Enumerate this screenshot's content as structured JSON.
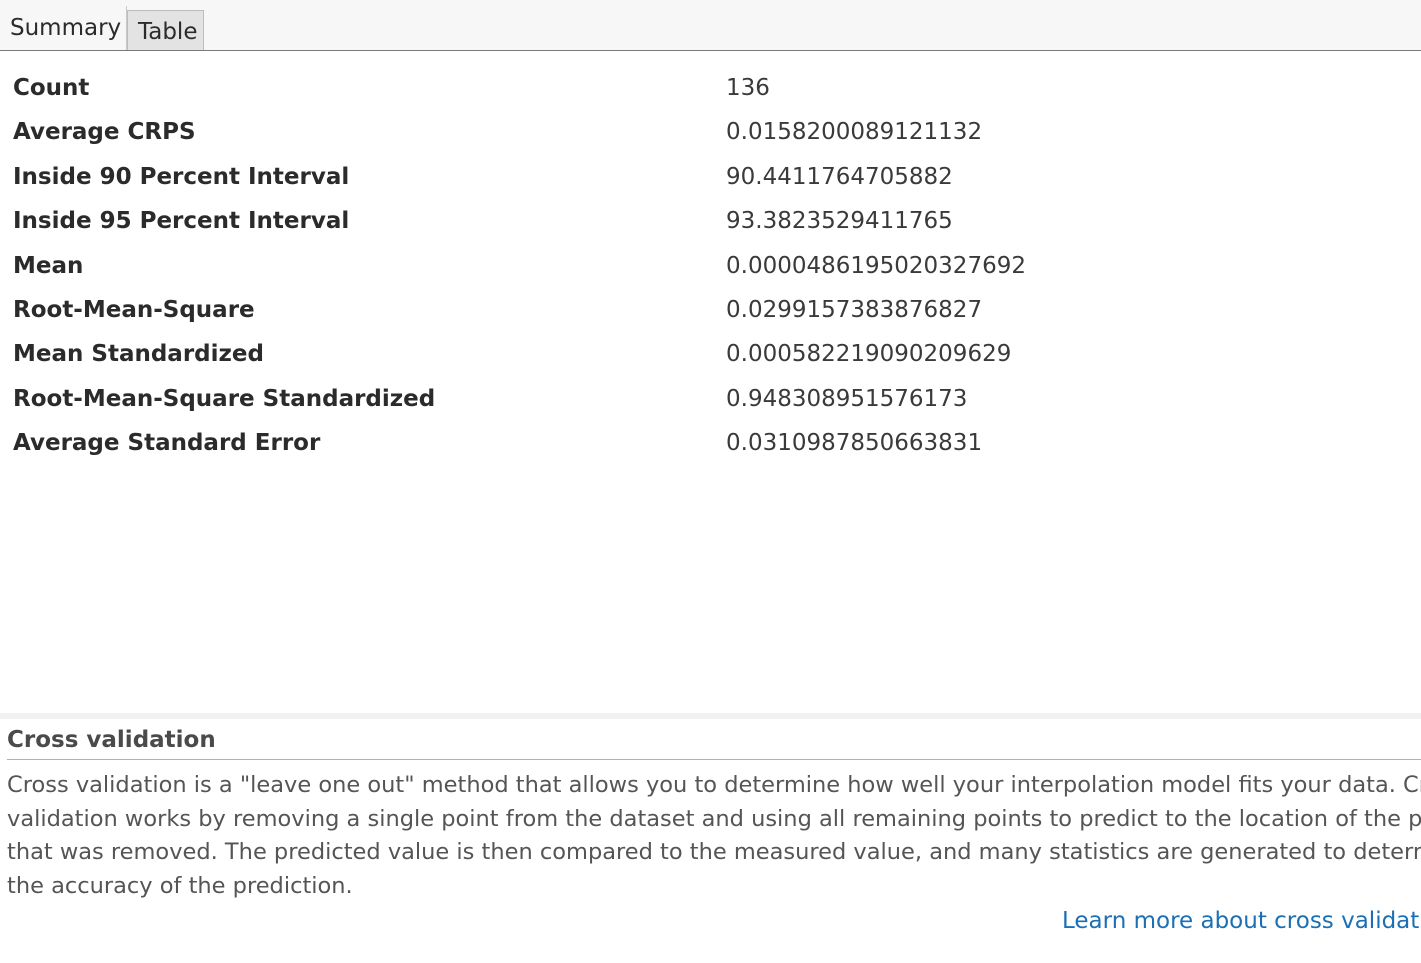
{
  "tabs": [
    {
      "label": "Summary",
      "active": true
    },
    {
      "label": "Table",
      "active": false
    }
  ],
  "stats": [
    {
      "label": "Count",
      "value": "136"
    },
    {
      "label": "Average CRPS",
      "value": "0.0158200089121132"
    },
    {
      "label": "Inside 90 Percent Interval",
      "value": "90.4411764705882"
    },
    {
      "label": "Inside 95 Percent Interval",
      "value": "93.3823529411765"
    },
    {
      "label": "Mean",
      "value": "0.0000486195020327692"
    },
    {
      "label": "Root-Mean-Square",
      "value": "0.0299157383876827"
    },
    {
      "label": "Mean Standardized",
      "value": "0.000582219090209629"
    },
    {
      "label": "Root-Mean-Square Standardized",
      "value": "0.948308951576173"
    },
    {
      "label": "Average Standard Error",
      "value": "0.0310987850663831"
    }
  ],
  "help": {
    "title": "Cross validation",
    "lines": [
      "Cross validation is a \"leave one out\" method that allows you to determine how well your interpolation model fits your data. Cross",
      "validation works by removing a single point from the dataset and using all remaining points to predict to the location of the point",
      "that was removed. The predicted value is then compared to the measured value, and many statistics are generated to determine",
      "the accuracy of the prediction."
    ],
    "link": "Learn more about cross validation"
  },
  "colors": {
    "link": "#1a6fb5",
    "rule": "#8fb9d9"
  }
}
